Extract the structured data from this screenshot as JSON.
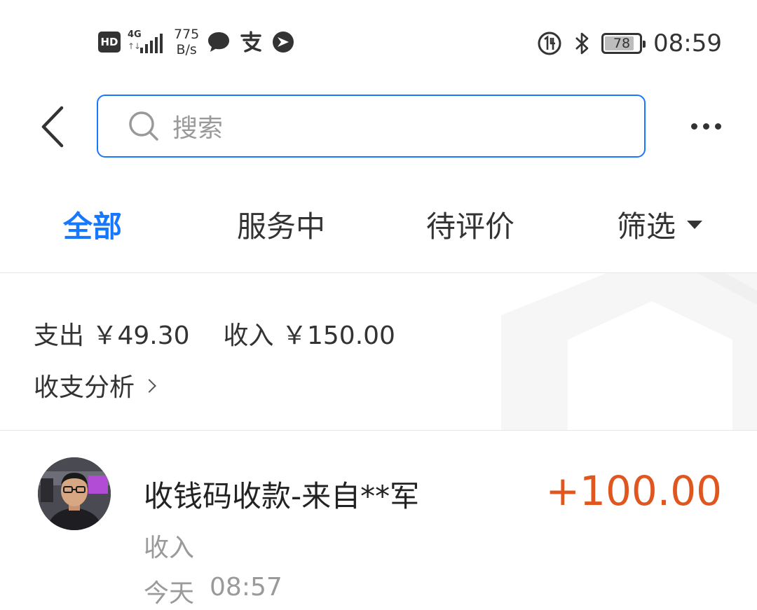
{
  "status_bar": {
    "hd": "HD",
    "network": "4G",
    "speed_value": "775",
    "speed_unit": "B/s",
    "battery": "78",
    "battery_level": 0.78,
    "time": "08:59"
  },
  "search": {
    "placeholder": "搜索"
  },
  "tabs": [
    {
      "label": "全部",
      "active": true
    },
    {
      "label": "服务中",
      "active": false
    },
    {
      "label": "待评价",
      "active": false
    },
    {
      "label": "筛选",
      "active": false
    }
  ],
  "summary": {
    "expense_label": "支出",
    "expense_value": "￥49.30",
    "income_label": "收入",
    "income_value": "￥150.00",
    "analysis_label": "收支分析"
  },
  "transactions": [
    {
      "title": "收钱码收款-来自**军",
      "amount": "+100.00",
      "type": "收入",
      "date": "今天",
      "time": "08:57"
    }
  ],
  "colors": {
    "accent": "#1677ff",
    "amount": "#e0561f",
    "muted": "#9a9a9a"
  }
}
